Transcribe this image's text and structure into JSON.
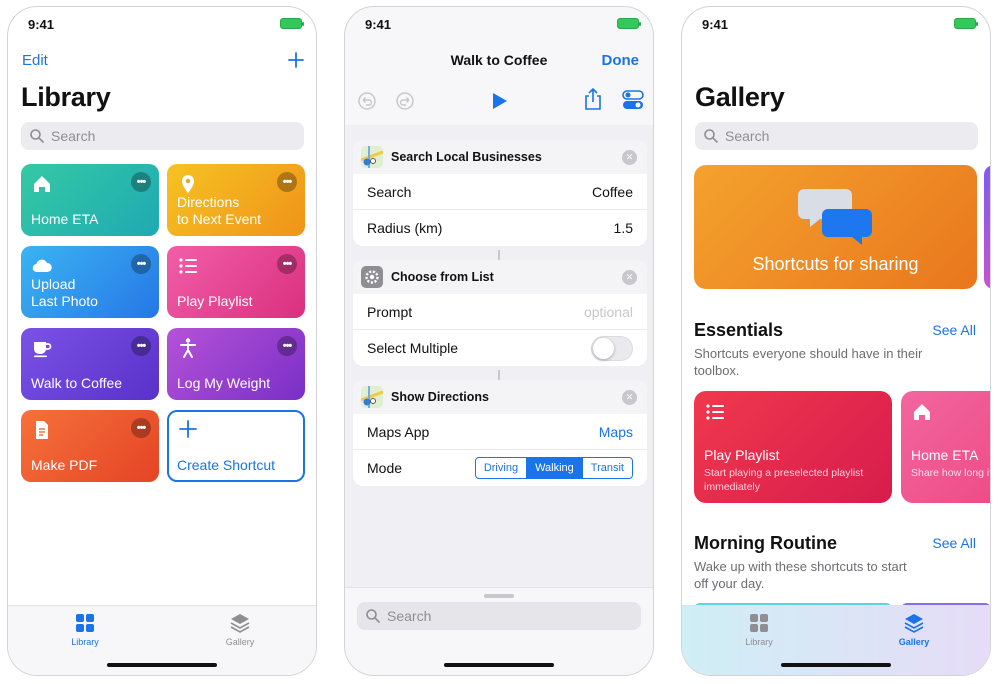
{
  "status": {
    "time": "9:41"
  },
  "library": {
    "edit_label": "Edit",
    "title": "Library",
    "search_placeholder": "Search",
    "tiles": [
      {
        "label": "Home ETA",
        "icon": "house-icon",
        "color": "#27b7a6"
      },
      {
        "label": "Directions\nto Next Event",
        "icon": "map-pin-icon",
        "color": "#f5a623"
      },
      {
        "label": "Upload\nLast Photo",
        "icon": "cloud-icon",
        "color": "#2d9cf0"
      },
      {
        "label": "Play Playlist",
        "icon": "list-icon",
        "color": "#e8438f"
      },
      {
        "label": "Walk to Coffee",
        "icon": "coffee-cup-icon",
        "color": "#6f3fd8"
      },
      {
        "label": "Log My Weight",
        "icon": "person-icon",
        "color": "#a23fd0"
      },
      {
        "label": "Make PDF",
        "icon": "document-icon",
        "color": "#ef5a2a"
      }
    ],
    "create_label": "Create Shortcut",
    "tabs": [
      {
        "label": "Library",
        "active": true
      },
      {
        "label": "Gallery",
        "active": false
      }
    ]
  },
  "editor": {
    "title": "Walk to Coffee",
    "done_label": "Done",
    "actions": [
      {
        "title": "Search Local Businesses",
        "rows": [
          {
            "label": "Search",
            "value": "Coffee"
          },
          {
            "label": "Radius (km)",
            "value": "1.5"
          }
        ]
      },
      {
        "title": "Choose from List",
        "rows": [
          {
            "label": "Prompt",
            "value": "optional"
          },
          {
            "label": "Select Multiple",
            "value": ""
          }
        ]
      },
      {
        "title": "Show Directions",
        "rows": [
          {
            "label": "Maps App",
            "value": "Maps"
          },
          {
            "label": "Mode",
            "value": ""
          }
        ]
      }
    ],
    "mode_options": [
      "Driving",
      "Walking",
      "Transit"
    ],
    "mode_selected": "Walking",
    "select_multiple_on": false,
    "search_placeholder": "Search"
  },
  "gallery": {
    "title": "Gallery",
    "search_placeholder": "Search",
    "hero_title": "Shortcuts for sharing",
    "essentials": {
      "title": "Essentials",
      "see_all": "See All",
      "description": "Shortcuts everyone should have in their toolbox.",
      "cards": [
        {
          "name": "Play Playlist",
          "desc": "Start playing a preselected playlist immediately",
          "icon": "list-icon",
          "color": "#e8304f"
        },
        {
          "name": "Home ETA",
          "desc": "Share how long it will take to get home",
          "icon": "house-icon",
          "color": "#f25a8f"
        }
      ]
    },
    "morning": {
      "title": "Morning Routine",
      "see_all": "See All",
      "description": "Wake up with these shortcuts to start off your day."
    },
    "tabs": [
      {
        "label": "Library",
        "active": false
      },
      {
        "label": "Gallery",
        "active": true
      }
    ]
  },
  "colors": {
    "accent": "#1a73e8",
    "battery": "#34c759"
  }
}
